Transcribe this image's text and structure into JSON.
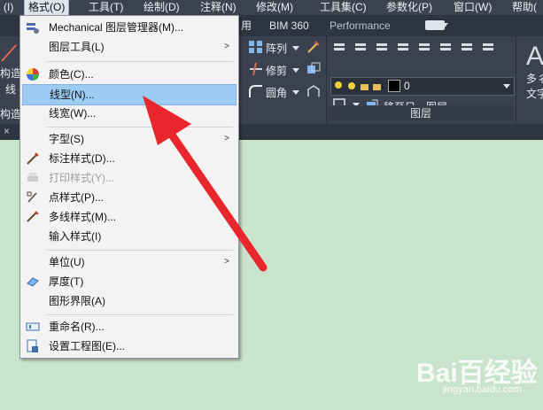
{
  "menubar": {
    "items": [
      {
        "label": "(I)"
      },
      {
        "label": "格式(O)"
      },
      {
        "label": "工具(T)"
      },
      {
        "label": "绘制(D)"
      },
      {
        "label": "注释(N)"
      },
      {
        "label": "修改(M)"
      },
      {
        "label": "工具集(C)"
      },
      {
        "label": "参数化(P)"
      },
      {
        "label": "窗口(W)"
      },
      {
        "label": "帮助("
      }
    ]
  },
  "ribbon": {
    "tabs": [
      {
        "label": "用"
      },
      {
        "label": "BIM 360"
      },
      {
        "label": "Performance"
      }
    ],
    "left": {
      "line1": "构造",
      "line2": "线",
      "line3": "构造"
    },
    "modify": {
      "array_label": "阵列",
      "trim_label": "修剪",
      "fillet_label": "圆角"
    },
    "layers": {
      "current_layer": "0",
      "move_to_other_label": "移至另一图层",
      "panel_title": "图层"
    },
    "right": {
      "big_letter": "A",
      "text1": "多彳",
      "text2": "文字"
    },
    "close_symbol": "×"
  },
  "format_menu": {
    "items": [
      {
        "label": "Mechanical 图层管理器(M)...",
        "icon": "layer-manager-icon",
        "submenu": false,
        "enabled": true
      },
      {
        "label": "图层工具(L)",
        "icon": "",
        "submenu": true,
        "enabled": true
      },
      {
        "label": "颜色(C)...",
        "icon": "color-wheel-icon",
        "submenu": false,
        "enabled": true
      },
      {
        "label": "线型(N)...",
        "icon": "",
        "submenu": false,
        "enabled": true,
        "highlighted": true
      },
      {
        "label": "线宽(W)...",
        "icon": "",
        "submenu": false,
        "enabled": true
      },
      {
        "label": "字型(S)",
        "icon": "",
        "submenu": true,
        "enabled": true
      },
      {
        "label": "标注样式(D)...",
        "icon": "dimension-style-icon",
        "submenu": false,
        "enabled": true
      },
      {
        "label": "打印样式(Y)...",
        "icon": "plot-style-icon",
        "submenu": false,
        "enabled": false
      },
      {
        "label": "点样式(P)...",
        "icon": "point-style-icon",
        "submenu": false,
        "enabled": true
      },
      {
        "label": "多线样式(M)...",
        "icon": "multiline-style-icon",
        "submenu": false,
        "enabled": true
      },
      {
        "label": "输入样式(I)",
        "icon": "",
        "submenu": false,
        "enabled": true
      },
      {
        "label": "单位(U)",
        "icon": "",
        "submenu": true,
        "enabled": true
      },
      {
        "label": "厚度(T)",
        "icon": "thickness-icon",
        "submenu": false,
        "enabled": true
      },
      {
        "label": "图形界限(A)",
        "icon": "",
        "submenu": false,
        "enabled": true
      },
      {
        "label": "重命名(R)...",
        "icon": "rename-icon",
        "submenu": false,
        "enabled": true
      },
      {
        "label": "设置工程图(E)...",
        "icon": "drawing-setup-icon",
        "submenu": false,
        "enabled": true
      }
    ],
    "submenu_arrow": ">"
  },
  "watermark": {
    "text": "Bai百经验",
    "url": "jingyan.baidu.com"
  },
  "colors": {
    "annotation_arrow": "#e8262b",
    "canvas": "#c9e4cc",
    "highlight": "#9ccbf4"
  }
}
